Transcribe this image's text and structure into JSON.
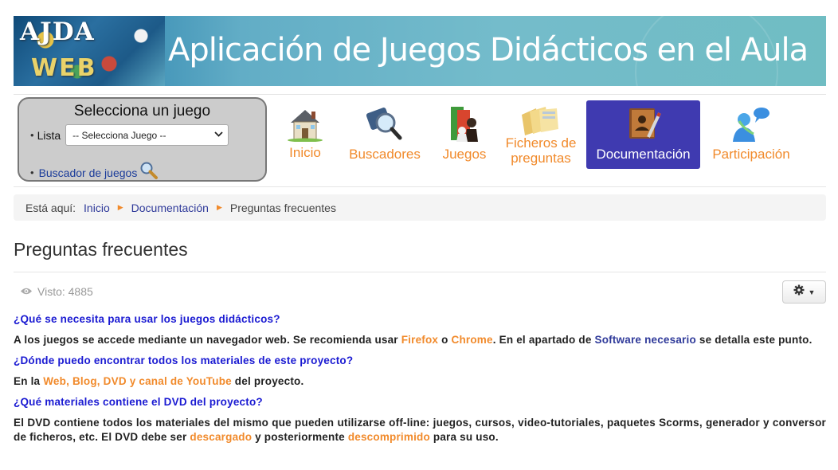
{
  "banner": {
    "logo_line1": "AJDA",
    "logo_line2": "WEB",
    "title": "Aplicación de Juegos Didácticos en el Aula"
  },
  "selector": {
    "title": "Selecciona un juego",
    "bullet": "•",
    "lista_label": "Lista",
    "select_value": "-- Selecciona Juego --",
    "buscador_link": "Buscador de juegos"
  },
  "nav": [
    {
      "label": "Inicio",
      "icon": "house-icon"
    },
    {
      "label": "Buscadores",
      "icon": "magnifier-icon"
    },
    {
      "label": "Juegos",
      "icon": "chess-icon"
    },
    {
      "label": "Ficheros de preguntas",
      "icon": "folders-icon"
    },
    {
      "label": "Documentación",
      "icon": "book-icon",
      "active": true
    },
    {
      "label": "Participación",
      "icon": "user-chat-icon"
    }
  ],
  "breadcrumb": {
    "prefix": "Está aquí:",
    "items": [
      "Inicio",
      "Documentación"
    ],
    "current": "Preguntas frecuentes"
  },
  "page": {
    "title": "Preguntas frecuentes",
    "views": "Visto: 4885"
  },
  "faq": {
    "q1": "¿Qué se necesita para usar los juegos didácticos?",
    "a1_p1": "A los juegos se accede mediante un navegador web. Se recomienda usar ",
    "a1_link1": "Firefox",
    "a1_p2": " o ",
    "a1_link2": "Chrome",
    "a1_p3": ". En el apartado de ",
    "a1_link3": "Software necesario",
    "a1_p4": " se detalla este punto.",
    "q2": "¿Dónde puedo encontrar todos los materiales de este proyecto?",
    "a2_p1": "En la ",
    "a2_link1": "Web, Blog, DVD y canal de YouTube",
    "a2_p2": " del proyecto.",
    "q3": "¿Qué materiales contiene el DVD del proyecto?",
    "a3_p1": "El DVD contiene todos los materiales del mismo que pueden utilizarse off-line: juegos, cursos, video-tutoriales, paquetes Scorms, generador y conversor de ficheros, etc. El DVD debe ser ",
    "a3_link1": "descargado",
    "a3_p2": " y posteriormente ",
    "a3_link2": "descomprimido",
    "a3_p3": " para su uso."
  },
  "colors": {
    "link_orange": "#f18a2b",
    "link_blue": "#2f3a9a",
    "question_blue": "#1a1ad2",
    "active_nav": "#3f3ab0"
  }
}
